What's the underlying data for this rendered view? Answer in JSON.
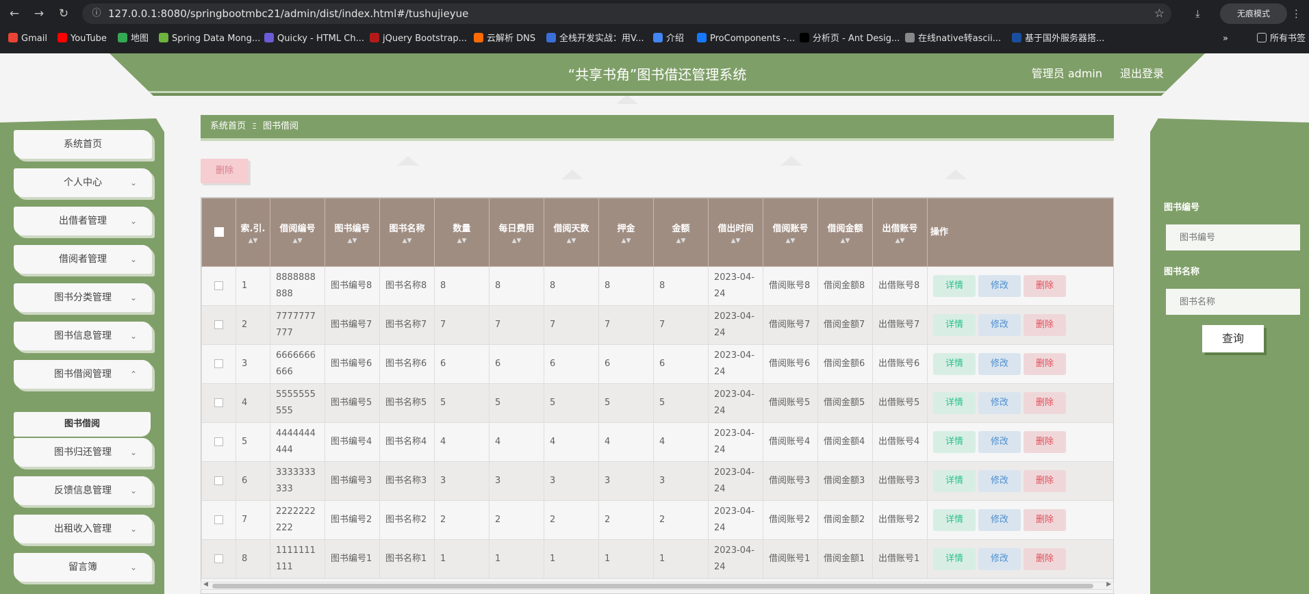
{
  "browser": {
    "url": "127.0.0.1:8080/springbootmbc21/admin/dist/index.html#/tushujieyue",
    "incognito_label": "无痕模式",
    "all_bookmarks_label": "所有书签",
    "bookmarks": [
      {
        "label": "Gmail",
        "icon_color": "#ea4335"
      },
      {
        "label": "YouTube",
        "icon_color": "#ff0000"
      },
      {
        "label": "地图",
        "icon_color": "#34a853"
      },
      {
        "label": "Spring Data Mong...",
        "icon_color": "#6db33f"
      },
      {
        "label": "Quicky - HTML Ch...",
        "icon_color": "#6b5bd6"
      },
      {
        "label": "jQuery Bootstrap...",
        "icon_color": "#b31b1b"
      },
      {
        "label": "云解析 DNS",
        "icon_color": "#ff6a00"
      },
      {
        "label": "全栈开发实战：用V...",
        "icon_color": "#3b6fd8"
      },
      {
        "label": "介绍",
        "icon_color": "#4285f4"
      },
      {
        "label": "ProComponents -...",
        "icon_color": "#1677ff"
      },
      {
        "label": "分析页 - Ant Desig...",
        "icon_color": "#000000"
      },
      {
        "label": "在线native转ascii...",
        "icon_color": "#888888"
      },
      {
        "label": "基于国外服务器搭...",
        "icon_color": "#1a4fa0"
      }
    ]
  },
  "header": {
    "title": "“共享书角”图书借还管理系统",
    "admin_label": "管理员 admin",
    "logout_label": "退出登录"
  },
  "sidebar": {
    "items": [
      {
        "label": "系统首页",
        "has_arrow": false
      },
      {
        "label": "个人中心",
        "has_arrow": true,
        "arrow": "⌄"
      },
      {
        "label": "出借者管理",
        "has_arrow": true,
        "arrow": "⌄"
      },
      {
        "label": "借阅者管理",
        "has_arrow": true,
        "arrow": "⌄"
      },
      {
        "label": "图书分类管理",
        "has_arrow": true,
        "arrow": "⌄"
      },
      {
        "label": "图书信息管理",
        "has_arrow": true,
        "arrow": "⌄"
      },
      {
        "label": "图书借阅管理",
        "has_arrow": true,
        "arrow": "⌃"
      },
      {
        "label": "图书归还管理",
        "has_arrow": true,
        "arrow": "⌄"
      },
      {
        "label": "反馈信息管理",
        "has_arrow": true,
        "arrow": "⌄"
      },
      {
        "label": "出租收入管理",
        "has_arrow": true,
        "arrow": "⌄"
      },
      {
        "label": "留言簿",
        "has_arrow": true,
        "arrow": "⌄"
      }
    ],
    "sub_item": "图书借阅"
  },
  "breadcrumb": {
    "home": "系统首页",
    "separator": "Ξ",
    "current": "图书借阅"
  },
  "toolbar": {
    "delete_label": "删除"
  },
  "table": {
    "headers": [
      "索.引.",
      "借阅编号",
      "图书编号",
      "图书名称",
      "数量",
      "每日费用",
      "借阅天数",
      "押金",
      "金额",
      "借出时间",
      "借阅账号",
      "借阅金额",
      "出借账号",
      "操作"
    ],
    "rows": [
      [
        "1",
        "8888888888",
        "图书编号8",
        "图书名称8",
        "8",
        "8",
        "8",
        "8",
        "8",
        "2023-04-24",
        "借阅账号8",
        "借阅金额8",
        "出借账号8"
      ],
      [
        "2",
        "7777777777",
        "图书编号7",
        "图书名称7",
        "7",
        "7",
        "7",
        "7",
        "7",
        "2023-04-24",
        "借阅账号7",
        "借阅金额7",
        "出借账号7"
      ],
      [
        "3",
        "6666666666",
        "图书编号6",
        "图书名称6",
        "6",
        "6",
        "6",
        "6",
        "6",
        "2023-04-24",
        "借阅账号6",
        "借阅金额6",
        "出借账号6"
      ],
      [
        "4",
        "5555555555",
        "图书编号5",
        "图书名称5",
        "5",
        "5",
        "5",
        "5",
        "5",
        "2023-04-24",
        "借阅账号5",
        "借阅金额5",
        "出借账号5"
      ],
      [
        "5",
        "4444444444",
        "图书编号4",
        "图书名称4",
        "4",
        "4",
        "4",
        "4",
        "4",
        "2023-04-24",
        "借阅账号4",
        "借阅金额4",
        "出借账号4"
      ],
      [
        "6",
        "3333333333",
        "图书编号3",
        "图书名称3",
        "3",
        "3",
        "3",
        "3",
        "3",
        "2023-04-24",
        "借阅账号3",
        "借阅金额3",
        "出借账号3"
      ],
      [
        "7",
        "2222222222",
        "图书编号2",
        "图书名称2",
        "2",
        "2",
        "2",
        "2",
        "2",
        "2023-04-24",
        "借阅账号2",
        "借阅金额2",
        "出借账号2"
      ],
      [
        "8",
        "1111111111",
        "图书编号1",
        "图书名称1",
        "1",
        "1",
        "1",
        "1",
        "1",
        "2023-04-24",
        "借阅账号1",
        "借阅金额1",
        "出借账号1"
      ]
    ],
    "actions": {
      "detail": "详情",
      "edit": "修改",
      "delete": "删除"
    }
  },
  "search": {
    "book_no_label": "图书编号",
    "book_no_placeholder": "图书编号",
    "book_name_label": "图书名称",
    "book_name_placeholder": "图书名称",
    "button": "查询"
  },
  "colors": {
    "primary_green": "#7f9f68",
    "table_header": "#a08d82",
    "detail": "#2bbf8c",
    "edit": "#4d8fd0",
    "delete": "#e0505c"
  }
}
